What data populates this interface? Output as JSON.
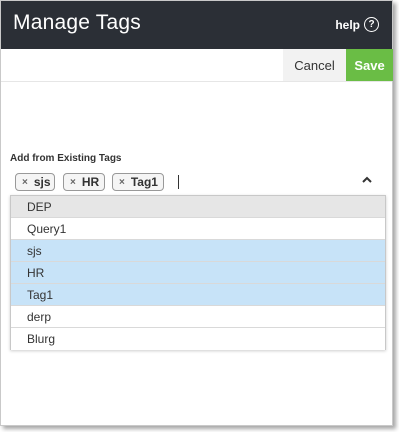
{
  "header": {
    "title": "Manage Tags",
    "help_label": "help",
    "help_icon": "?"
  },
  "toolbar": {
    "cancel_label": "Cancel",
    "save_label": "Save",
    "save_color": "#6abd45"
  },
  "tags_field": {
    "label": "Add from Existing Tags",
    "selected_tags": [
      "sjs",
      "HR",
      "Tag1"
    ],
    "remove_glyph": "×",
    "toggle_icon": "chevron-up-icon"
  },
  "dropdown": {
    "options": [
      {
        "label": "DEP",
        "state": "hover"
      },
      {
        "label": "Query1",
        "state": "normal"
      },
      {
        "label": "sjs",
        "state": "selected"
      },
      {
        "label": "HR",
        "state": "selected"
      },
      {
        "label": "Tag1",
        "state": "selected"
      },
      {
        "label": "derp",
        "state": "normal"
      },
      {
        "label": "Blurg",
        "state": "normal"
      }
    ],
    "colors": {
      "hover": "#e6e6e6",
      "selected": "#c7e3f8",
      "normal": "#ffffff"
    }
  }
}
